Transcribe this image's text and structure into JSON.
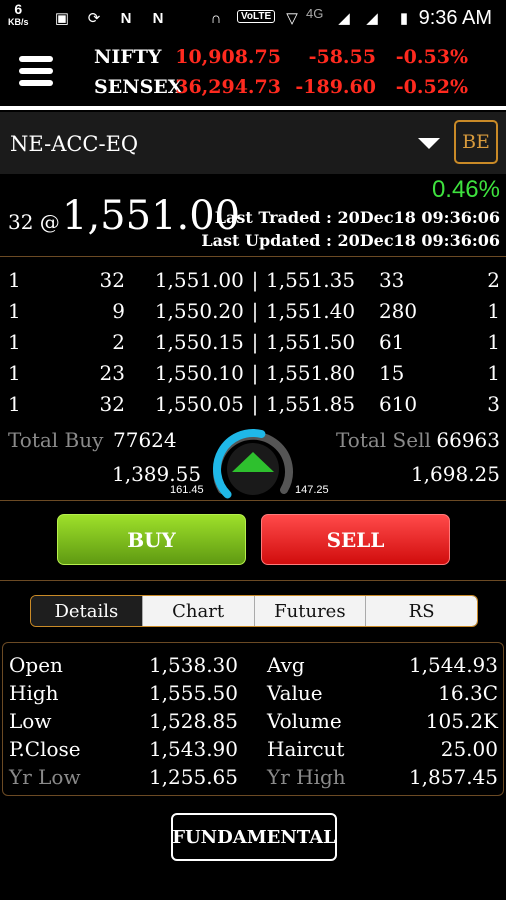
{
  "status_bar": {
    "speed": "6",
    "speed_unit": "KB/s",
    "volte": "VoLTE",
    "network": "4G",
    "time": "9:36 AM"
  },
  "indices": [
    {
      "name": "NIFTY",
      "value": "10,908.75",
      "change": "-58.55",
      "pct": "-0.53%"
    },
    {
      "name": "SENSEX",
      "value": "36,294.73",
      "change": "-189.60",
      "pct": "-0.52%"
    }
  ],
  "symbol": {
    "name": "NE-ACC-EQ",
    "series_button": "BE"
  },
  "quote": {
    "change_pct": "0.46%",
    "qty_prefix": "32 @",
    "ltp": "1,551.00",
    "last_traded": "Last Traded : 20Dec18 09:36:06",
    "last_updated": "Last Updated : 20Dec18 09:36:06"
  },
  "depth": [
    {
      "bo": "1",
      "bq": "32",
      "bp": "1,551.00",
      "sp": "1,551.35",
      "sq": "33",
      "so": "2"
    },
    {
      "bo": "1",
      "bq": "9",
      "bp": "1,550.20",
      "sp": "1,551.40",
      "sq": "280",
      "so": "1"
    },
    {
      "bo": "1",
      "bq": "2",
      "bp": "1,550.15",
      "sp": "1,551.50",
      "sq": "61",
      "so": "1"
    },
    {
      "bo": "1",
      "bq": "23",
      "bp": "1,550.10",
      "sp": "1,551.80",
      "sq": "15",
      "so": "1"
    },
    {
      "bo": "1",
      "bq": "32",
      "bp": "1,550.05",
      "sp": "1,551.85",
      "sq": "610",
      "so": "3"
    }
  ],
  "totals": {
    "buy_label": "Total Buy",
    "buy_value": "77624",
    "sell_label": "Total Sell",
    "sell_value": "66963",
    "low_price": "1,389.55",
    "high_price": "1,698.25",
    "gauge_left": "161.45",
    "gauge_right": "147.25",
    "gauge_level": 0.55
  },
  "actions": {
    "buy": "BUY",
    "sell": "SELL"
  },
  "tabs": [
    "Details",
    "Chart",
    "Futures",
    "RS"
  ],
  "details": {
    "left": [
      {
        "label": "Open",
        "value": "1,538.30"
      },
      {
        "label": "High",
        "value": "1,555.50"
      },
      {
        "label": "Low",
        "value": "1,528.85"
      },
      {
        "label": "P.Close",
        "value": "1,543.90"
      },
      {
        "label": "Yr Low",
        "value": "1,255.65"
      }
    ],
    "right": [
      {
        "label": "Avg",
        "value": "1,544.93"
      },
      {
        "label": "Value",
        "value": "16.3C"
      },
      {
        "label": "Volume",
        "value": "105.2K"
      },
      {
        "label": "Haircut",
        "value": "25.00"
      },
      {
        "label": "Yr High",
        "value": "1,857.45"
      }
    ]
  },
  "fundamental_button": "FUNDAMENTAL",
  "colors": {
    "accent": "#c98a27",
    "up": "#3ee23e",
    "down": "#ff2a1f",
    "buy": "#7cc21d",
    "sell": "#e41a1a"
  }
}
